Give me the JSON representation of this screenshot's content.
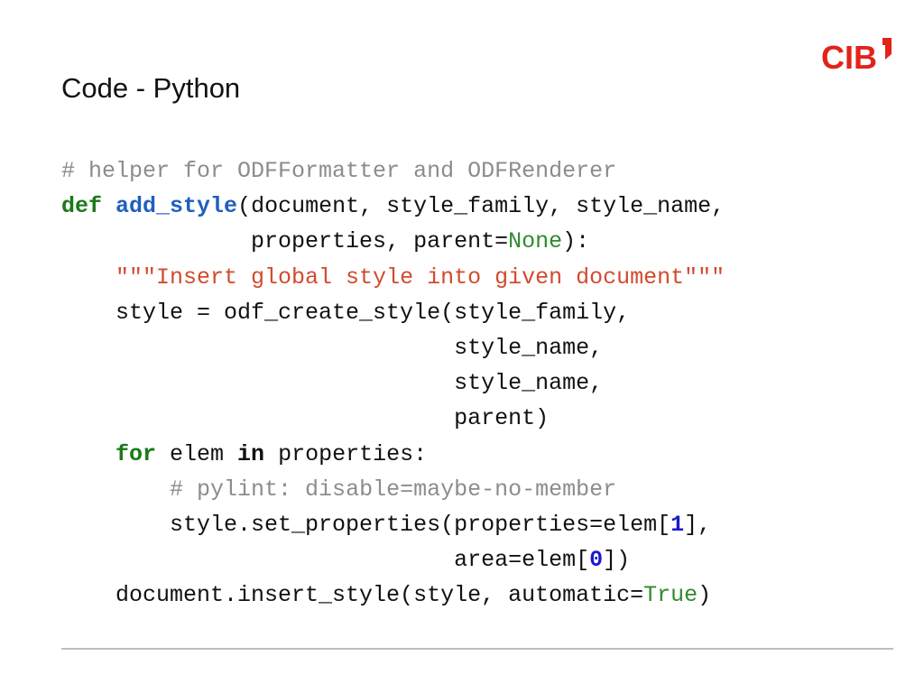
{
  "slide": {
    "title": "Code - Python",
    "logo_text": "CIB",
    "accent_color": "#e2231a"
  },
  "code": {
    "language": "python",
    "lines": [
      [
        {
          "t": "comment",
          "v": "# helper for ODFFormatter and ODFRenderer"
        }
      ],
      [
        {
          "t": "keyword",
          "v": "def"
        },
        {
          "t": "text",
          "v": " "
        },
        {
          "t": "funcname",
          "v": "add_style"
        },
        {
          "t": "text",
          "v": "(document, style_family, style_name,"
        }
      ],
      [
        {
          "t": "text",
          "v": "              properties, parent"
        },
        {
          "t": "text",
          "v": "="
        },
        {
          "t": "builtin",
          "v": "None"
        },
        {
          "t": "text",
          "v": "):"
        }
      ],
      [
        {
          "t": "text",
          "v": "    "
        },
        {
          "t": "string",
          "v": "\"\"\"Insert global style into given document\"\"\""
        }
      ],
      [
        {
          "t": "text",
          "v": "    style = odf_create_style(style_family,"
        }
      ],
      [
        {
          "t": "text",
          "v": "                             style_name,"
        }
      ],
      [
        {
          "t": "text",
          "v": "                             style_name,"
        }
      ],
      [
        {
          "t": "text",
          "v": "                             parent)"
        }
      ],
      [
        {
          "t": "text",
          "v": "    "
        },
        {
          "t": "keyword",
          "v": "for"
        },
        {
          "t": "text",
          "v": " elem "
        },
        {
          "t": "operator",
          "v": "in"
        },
        {
          "t": "text",
          "v": " properties:"
        }
      ],
      [
        {
          "t": "text",
          "v": "        "
        },
        {
          "t": "comment",
          "v": "# pylint: disable=maybe-no-member"
        }
      ],
      [
        {
          "t": "text",
          "v": "        style.set_properties(properties=elem["
        },
        {
          "t": "number",
          "v": "1"
        },
        {
          "t": "text",
          "v": "],"
        }
      ],
      [
        {
          "t": "text",
          "v": "                             area=elem["
        },
        {
          "t": "number",
          "v": "0"
        },
        {
          "t": "text",
          "v": "])"
        }
      ],
      [
        {
          "t": "text",
          "v": "    document.insert_style(style, automatic="
        },
        {
          "t": "builtin",
          "v": "True"
        },
        {
          "t": "text",
          "v": ")"
        }
      ]
    ]
  }
}
